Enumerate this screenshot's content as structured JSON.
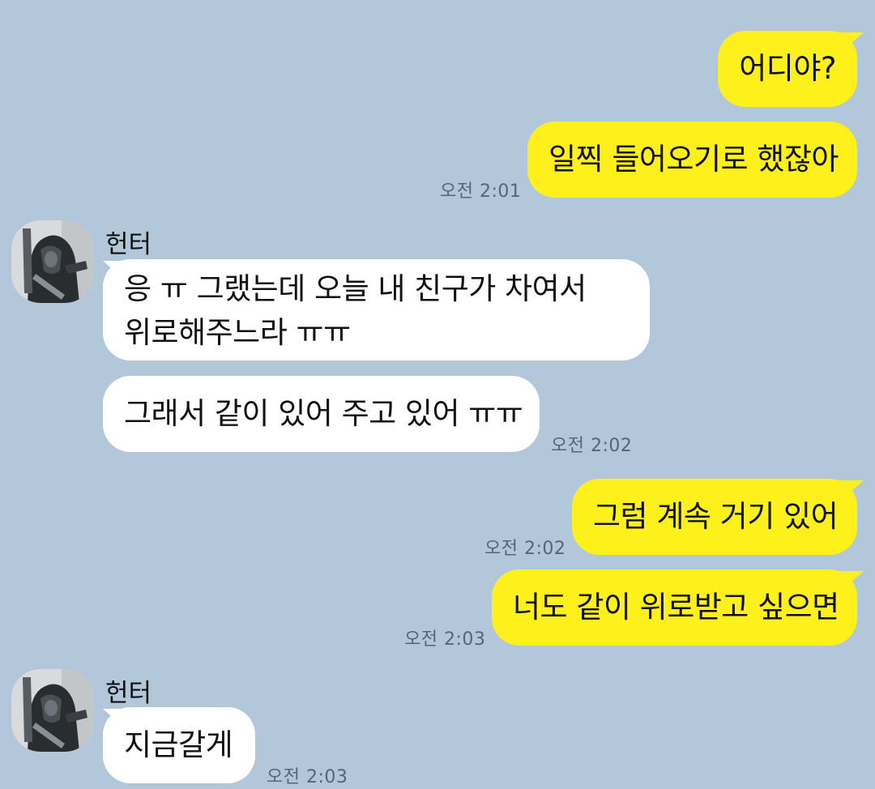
{
  "chat": {
    "background_color": "#b2c7d9",
    "my_bubble_color": "#fef01b",
    "their_bubble_color": "#ffffff",
    "messages": [
      {
        "text": "어디야?"
      },
      {
        "text": "일찍 들어오기로 했잖아",
        "time": "오전 2:01"
      },
      {
        "sender": "헌터",
        "avatar": "hooded-figure-avatar",
        "text": "응 ㅠ 그랬는데 오늘 내 친구가 차여서\n위로해주느라 ㅠㅠ"
      },
      {
        "text": "그래서 같이 있어 주고 있어 ㅠㅠ",
        "time": "오전 2:02"
      },
      {
        "text": "그럼 계속 거기 있어",
        "time": "오전 2:02"
      },
      {
        "text": "너도 같이 위로받고 싶으면",
        "time": "오전 2:03"
      },
      {
        "sender": "헌터",
        "avatar": "hooded-figure-avatar",
        "text": "지금갈게",
        "time": "오전 2:03"
      }
    ]
  }
}
